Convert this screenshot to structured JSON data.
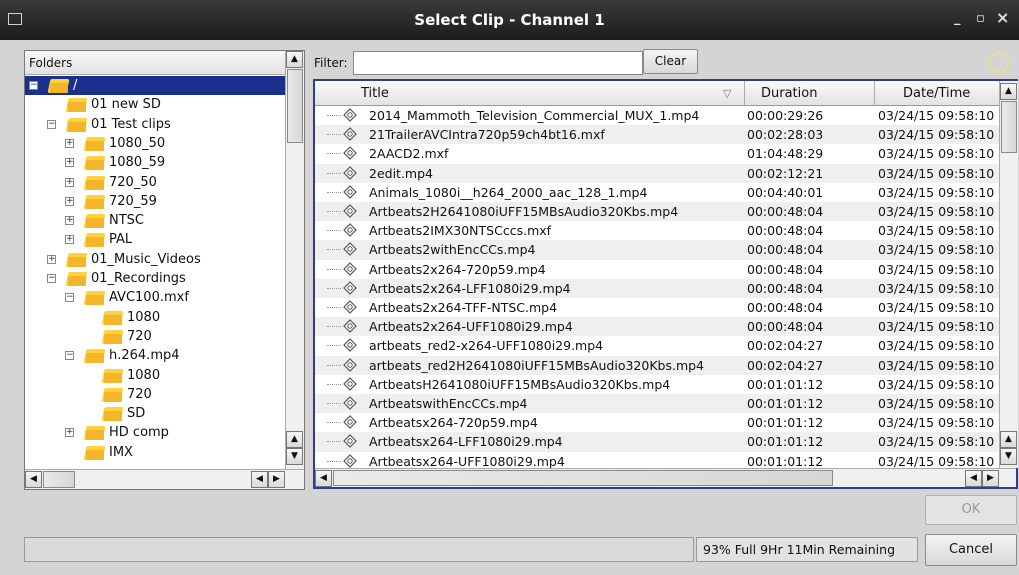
{
  "window": {
    "title": "Select Clip - Channel 1",
    "minimize_glyph": "_",
    "maximize_glyph": "▫",
    "close_glyph": "×"
  },
  "folders": {
    "header": "Folders",
    "tree": [
      {
        "label": "/",
        "depth": 0,
        "expander": "−",
        "selected": true
      },
      {
        "label": "01 new SD",
        "depth": 1,
        "expander": ""
      },
      {
        "label": "01 Test clips",
        "depth": 1,
        "expander": "−"
      },
      {
        "label": "1080_50",
        "depth": 2,
        "expander": "+"
      },
      {
        "label": "1080_59",
        "depth": 2,
        "expander": "+"
      },
      {
        "label": "720_50",
        "depth": 2,
        "expander": "+"
      },
      {
        "label": "720_59",
        "depth": 2,
        "expander": "+"
      },
      {
        "label": "NTSC",
        "depth": 2,
        "expander": "+"
      },
      {
        "label": "PAL",
        "depth": 2,
        "expander": "+"
      },
      {
        "label": "01_Music_Videos",
        "depth": 1,
        "expander": "+"
      },
      {
        "label": "01_Recordings",
        "depth": 1,
        "expander": "−"
      },
      {
        "label": "AVC100.mxf",
        "depth": 2,
        "expander": "−"
      },
      {
        "label": "1080",
        "depth": 3,
        "expander": ""
      },
      {
        "label": "720",
        "depth": 3,
        "expander": ""
      },
      {
        "label": "h.264.mp4",
        "depth": 2,
        "expander": "−"
      },
      {
        "label": "1080",
        "depth": 3,
        "expander": ""
      },
      {
        "label": "720",
        "depth": 3,
        "expander": ""
      },
      {
        "label": "SD",
        "depth": 3,
        "expander": ""
      },
      {
        "label": "HD comp",
        "depth": 2,
        "expander": "+"
      },
      {
        "label": "IMX",
        "depth": 2,
        "expander": ""
      }
    ]
  },
  "filter": {
    "label": "Filter:",
    "value": "",
    "placeholder": "",
    "clear_label": "Clear"
  },
  "table": {
    "columns": {
      "title": "Title",
      "duration": "Duration",
      "datetime": "Date/Time"
    },
    "rows": [
      {
        "title": "2014_Mammoth_Television_Commercial_MUX_1.mp4",
        "duration": "00:00:29:26",
        "datetime": "03/24/15 09:58:10"
      },
      {
        "title": "21TrailerAVCIntra720p59ch4bt16.mxf",
        "duration": "00:02:28:03",
        "datetime": "03/24/15 09:58:10"
      },
      {
        "title": "2AACD2.mxf",
        "duration": "01:04:48:29",
        "datetime": "03/24/15 09:58:10"
      },
      {
        "title": "2edit.mp4",
        "duration": "00:02:12:21",
        "datetime": "03/24/15 09:58:10"
      },
      {
        "title": "Animals_1080i__h264_2000_aac_128_1.mp4",
        "duration": "00:04:40:01",
        "datetime": "03/24/15 09:58:10"
      },
      {
        "title": "Artbeats2H2641080iUFF15MBsAudio320Kbs.mp4",
        "duration": "00:00:48:04",
        "datetime": "03/24/15 09:58:10"
      },
      {
        "title": "Artbeats2IMX30NTSCccs.mxf",
        "duration": "00:00:48:04",
        "datetime": "03/24/15 09:58:10"
      },
      {
        "title": "Artbeats2withEncCCs.mp4",
        "duration": "00:00:48:04",
        "datetime": "03/24/15 09:58:10"
      },
      {
        "title": "Artbeats2x264-720p59.mp4",
        "duration": "00:00:48:04",
        "datetime": "03/24/15 09:58:10"
      },
      {
        "title": "Artbeats2x264-LFF1080i29.mp4",
        "duration": "00:00:48:04",
        "datetime": "03/24/15 09:58:10"
      },
      {
        "title": "Artbeats2x264-TFF-NTSC.mp4",
        "duration": "00:00:48:04",
        "datetime": "03/24/15 09:58:10"
      },
      {
        "title": "Artbeats2x264-UFF1080i29.mp4",
        "duration": "00:00:48:04",
        "datetime": "03/24/15 09:58:10"
      },
      {
        "title": "artbeats_red2-x264-UFF1080i29.mp4",
        "duration": "00:02:04:27",
        "datetime": "03/24/15 09:58:10"
      },
      {
        "title": "artbeats_red2H2641080iUFF15MBsAudio320Kbs.mp4",
        "duration": "00:02:04:27",
        "datetime": "03/24/15 09:58:10"
      },
      {
        "title": "ArtbeatsH2641080iUFF15MBsAudio320Kbs.mp4",
        "duration": "00:01:01:12",
        "datetime": "03/24/15 09:58:10"
      },
      {
        "title": "ArtbeatswithEncCCs.mp4",
        "duration": "00:01:01:12",
        "datetime": "03/24/15 09:58:10"
      },
      {
        "title": "Artbeatsx264-720p59.mp4",
        "duration": "00:01:01:12",
        "datetime": "03/24/15 09:58:10"
      },
      {
        "title": "Artbeatsx264-LFF1080i29.mp4",
        "duration": "00:01:01:12",
        "datetime": "03/24/15 09:58:10"
      },
      {
        "title": "Artbeatsx264-UFF1080i29.mp4",
        "duration": "00:01:01:12",
        "datetime": "03/24/15 09:58:10"
      }
    ]
  },
  "footer": {
    "ok_label": "OK",
    "cancel_label": "Cancel",
    "disk_status": "93% Full  9Hr 11Min Remaining",
    "status_text": ""
  },
  "icons": {
    "folder": "folder-icon",
    "clip": "clip-icon",
    "sort": "sort-desc-icon"
  }
}
